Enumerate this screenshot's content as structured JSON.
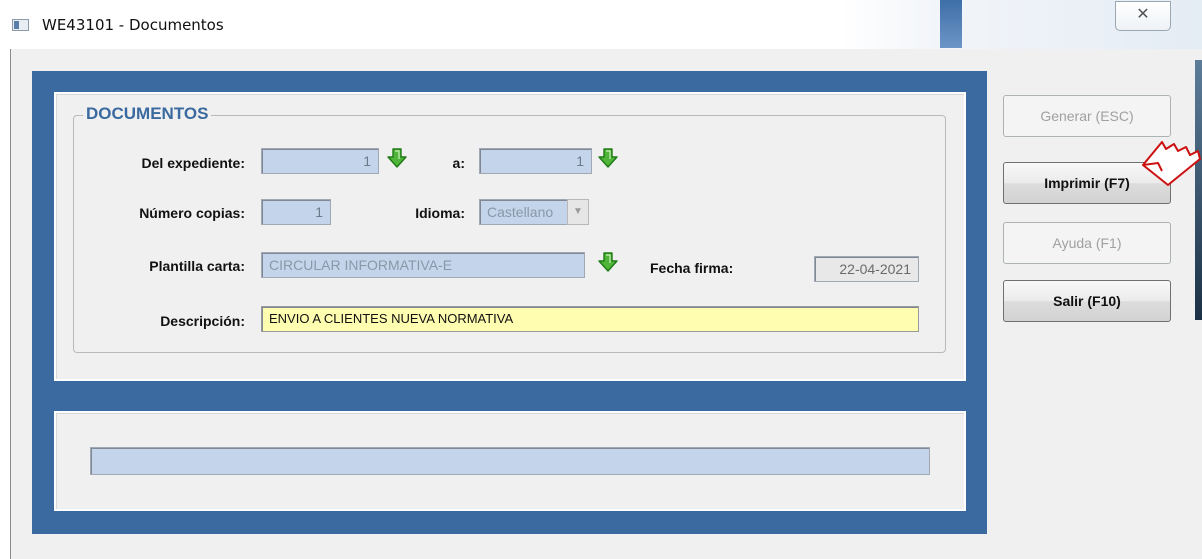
{
  "window": {
    "title": "WE43101 - Documentos"
  },
  "group": {
    "title": "DOCUMENTOS"
  },
  "form": {
    "del_expediente": {
      "label": "Del expediente:",
      "value": "1"
    },
    "a": {
      "label": "a:",
      "value": "1"
    },
    "numero_copias": {
      "label": "Número copias:",
      "value": "1"
    },
    "idioma": {
      "label": "Idioma:",
      "value": "Castellano"
    },
    "plantilla": {
      "label": "Plantilla carta:",
      "value": "CIRCULAR INFORMATIVA-E"
    },
    "fecha_firma": {
      "label": "Fecha firma:",
      "value": "22-04-2021"
    },
    "descripcion": {
      "label": "Descripción:",
      "value": "ENVIO A CLIENTES NUEVA NORMATIVA"
    }
  },
  "status": {
    "value": ""
  },
  "buttons": {
    "generar": "Generar (ESC)",
    "imprimir": "Imprimir (F7)",
    "ayuda": "Ayuda (F1)",
    "salir": "Salir (F10)"
  },
  "icons": {
    "close": "close-icon",
    "lookup": "green-down-arrow-icon",
    "pointer": "pointing-hand-annotation-icon"
  },
  "colors": {
    "frame": "#3a6a9f",
    "field_bg": "#c4d5eb",
    "description_bg": "#fffdb0",
    "group_title": "#3a6a9f",
    "lookup_arrow": "#3fa22a",
    "pointer": "#cc1111"
  }
}
